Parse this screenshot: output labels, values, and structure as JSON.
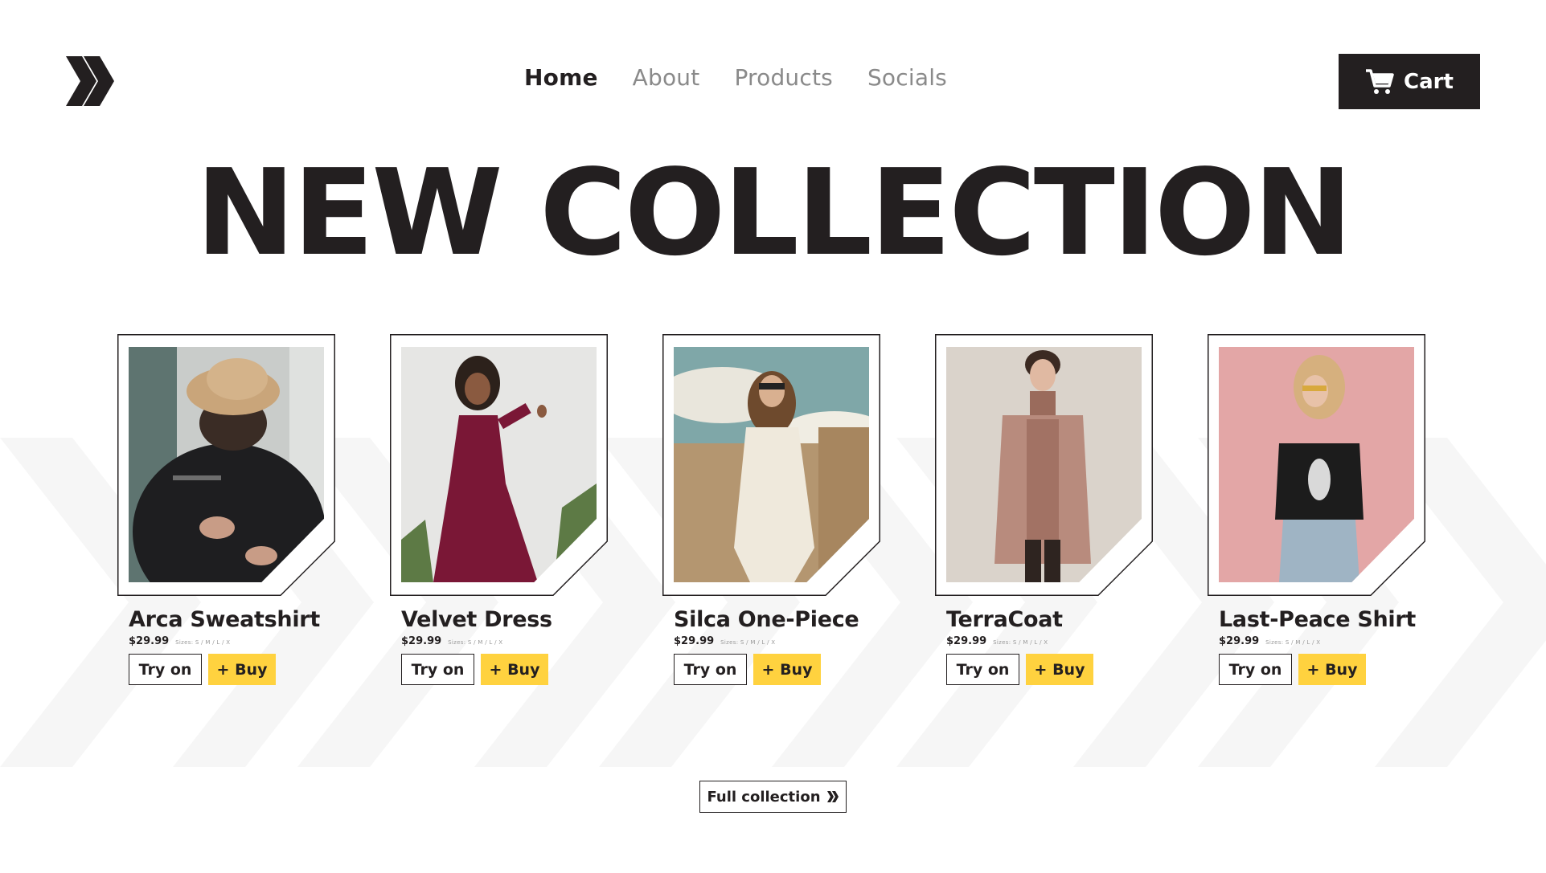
{
  "colors": {
    "dark": "#231f20",
    "accent": "#ffd23f",
    "muted": "#8a8a8a",
    "pattern": "#f6f6f6"
  },
  "header": {
    "logo_icon": "double-chevron-logo",
    "nav": [
      {
        "label": "Home",
        "active": true
      },
      {
        "label": "About",
        "active": false
      },
      {
        "label": "Products",
        "active": false
      },
      {
        "label": "Socials",
        "active": false
      }
    ],
    "cart": {
      "label": "Cart",
      "icon": "shopping-cart-icon"
    }
  },
  "hero": {
    "title": "NEW COLLECTION"
  },
  "products": [
    {
      "name": "Arca Sweatshirt",
      "price": "$29.99",
      "sizes": "Sizes: S / M / L / X",
      "try_label": "Try on",
      "buy_label": "+ Buy"
    },
    {
      "name": "Velvet Dress",
      "price": "$29.99",
      "sizes": "Sizes: S / M / L / X",
      "try_label": "Try on",
      "buy_label": "+ Buy"
    },
    {
      "name": "Silca One-Piece",
      "price": "$29.99",
      "sizes": "Sizes: S / M / L / X",
      "try_label": "Try on",
      "buy_label": "+ Buy"
    },
    {
      "name": "TerraCoat",
      "price": "$29.99",
      "sizes": "Sizes: S / M / L / X",
      "try_label": "Try on",
      "buy_label": "+ Buy"
    },
    {
      "name": "Last-Peace Shirt",
      "price": "$29.99",
      "sizes": "Sizes: S / M / L / X",
      "try_label": "Try on",
      "buy_label": "+ Buy"
    }
  ],
  "footer": {
    "full_collection_label": "Full collection",
    "full_collection_icon": "double-chevron-right-icon"
  }
}
